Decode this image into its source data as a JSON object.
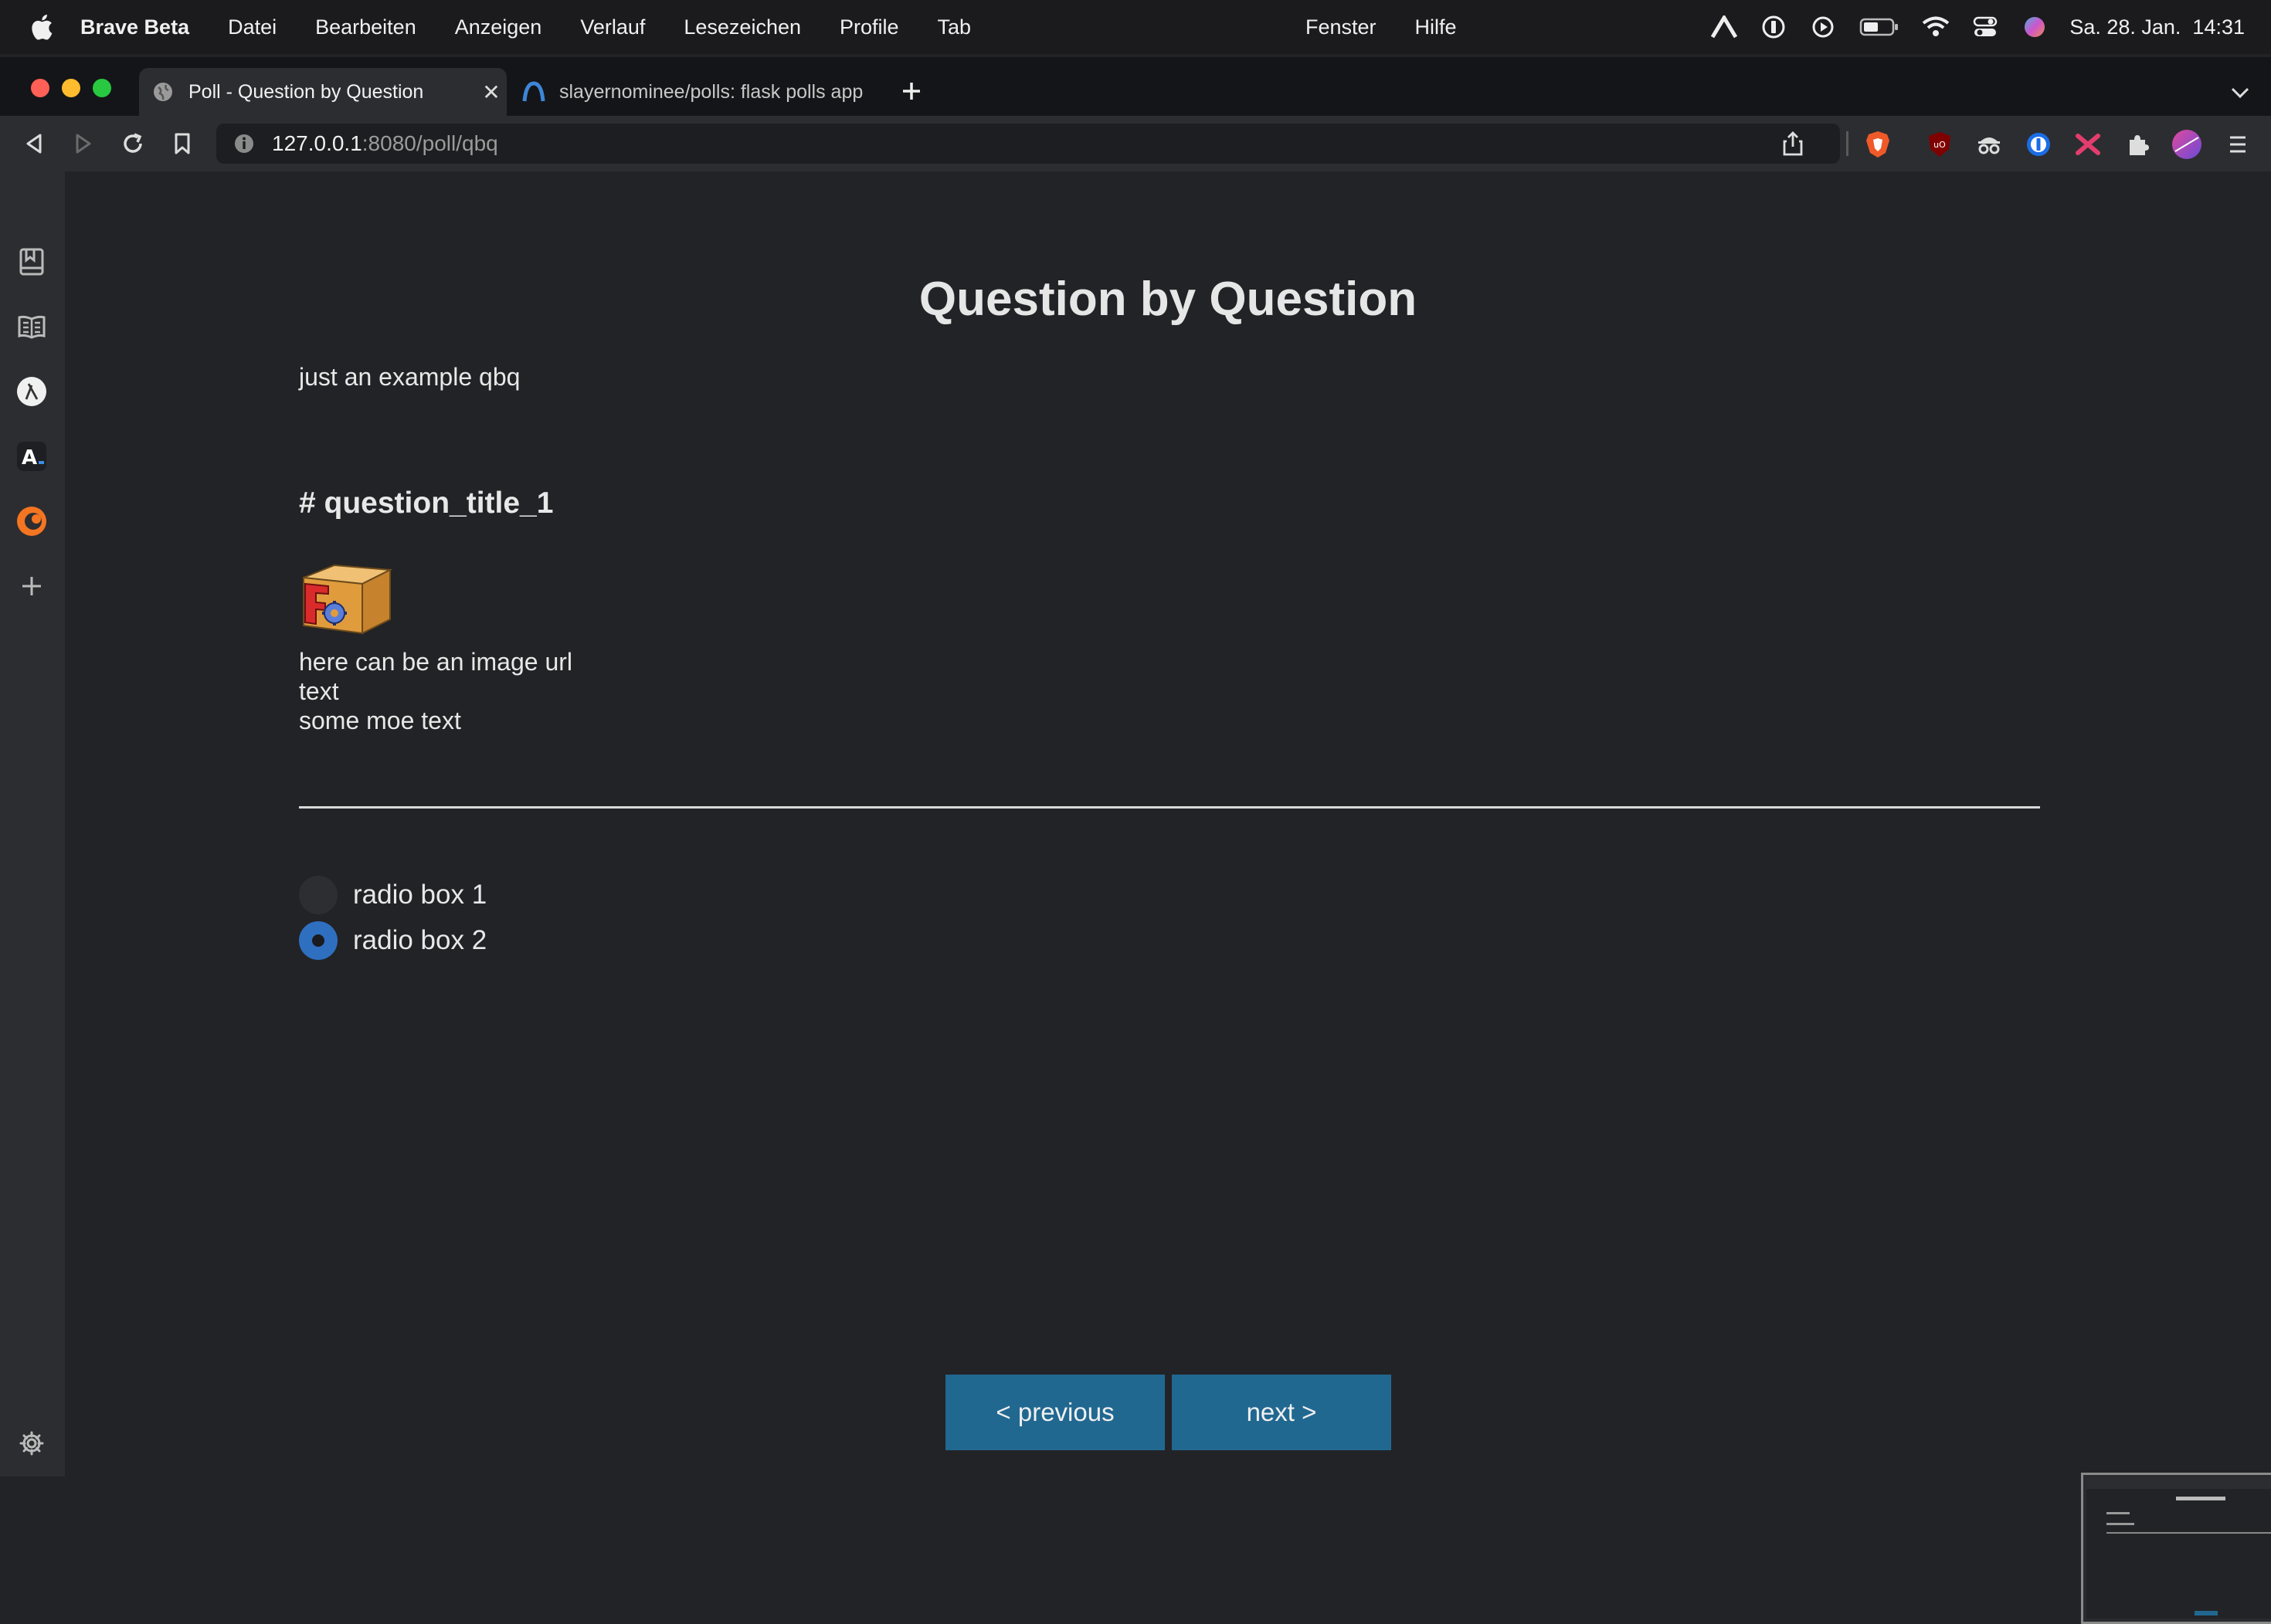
{
  "menubar": {
    "app_name": "Brave Beta",
    "items": [
      "Datei",
      "Bearbeiten",
      "Anzeigen",
      "Verlauf",
      "Lesezeichen",
      "Profile",
      "Tab"
    ],
    "right_items": [
      "Fenster",
      "Hilfe"
    ],
    "datetime": "Sa. 28. Jan.  14:31"
  },
  "tabs": [
    {
      "title": "Poll - Question by Question",
      "active": true
    },
    {
      "title": "slayernominee/polls: flask polls app",
      "active": false
    }
  ],
  "address_bar": {
    "host": "127.0.0.1",
    "path": ":8080/poll/qbq"
  },
  "page": {
    "title": "Question by Question",
    "description": "just an example qbq",
    "question_title": "# question_title_1",
    "question_lines": [
      "here can be an image url",
      "text",
      "some moe text"
    ],
    "options": [
      {
        "label": "radio box 1",
        "checked": false
      },
      {
        "label": "radio box 2",
        "checked": true
      }
    ],
    "prev_label": "< previous",
    "next_label": "next >"
  },
  "colors": {
    "background": "#222326",
    "button": "#216891",
    "radio_checked": "#2f6fc0"
  }
}
